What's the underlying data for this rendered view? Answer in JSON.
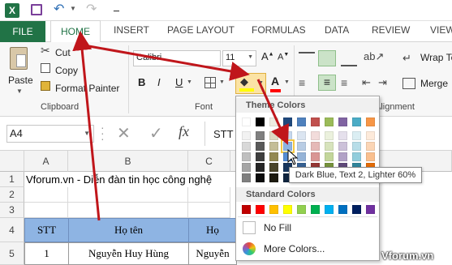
{
  "ribbon_tabs": [
    "FILE",
    "HOME",
    "INSERT",
    "PAGE LAYOUT",
    "FORMULAS",
    "DATA",
    "REVIEW",
    "VIEW"
  ],
  "clipboard": {
    "paste": "Paste",
    "cut": "Cut",
    "copy": "Copy",
    "format_painter": "Format Painter",
    "group": "Clipboard"
  },
  "font": {
    "name": "Calibri",
    "size": "11",
    "bold": "B",
    "italic": "I",
    "underline": "U",
    "group": "Font",
    "font_color_letter": "A"
  },
  "alignment": {
    "wrap": "Wrap Text",
    "merge": "Merge",
    "group": "Alignment"
  },
  "formula_bar": {
    "name_box": "A4",
    "fx": "fx",
    "content": "STT"
  },
  "columns": [
    "A",
    "B",
    "C"
  ],
  "rows": [
    "1",
    "2",
    "3",
    "4",
    "5"
  ],
  "sheet": {
    "title": "Vforum.vn - Diễn đàn tin học công nghệ",
    "headers": [
      "STT",
      "Họ tên",
      "Họ"
    ],
    "row5": [
      "1",
      "Nguyễn Huy Hùng",
      "Nguyễn"
    ]
  },
  "popup": {
    "theme_title": "Theme Colors",
    "standard_title": "Standard Colors",
    "no_fill": "No Fill",
    "more": "More Colors...",
    "tooltip": "Dark Blue, Text 2, Lighter 60%"
  },
  "theme_colors": [
    [
      "#ffffff",
      "#000000",
      "#eeece1",
      "#1f497d",
      "#4f81bd",
      "#c0504d",
      "#9bbb59",
      "#8064a2",
      "#4bacc6",
      "#f79646"
    ],
    [
      "#f2f2f2",
      "#7f7f7f",
      "#ddd9c3",
      "#c6d9f0",
      "#dbe5f1",
      "#f2dcdb",
      "#ebf1dd",
      "#e5e0ec",
      "#dbeef3",
      "#fdeada"
    ],
    [
      "#d8d8d8",
      "#595959",
      "#c4bd97",
      "#8db3e2",
      "#b8cce4",
      "#e5b9b7",
      "#d7e3bc",
      "#ccc1d9",
      "#b7dde8",
      "#fbd5b5"
    ],
    [
      "#bfbfbf",
      "#3f3f3f",
      "#938953",
      "#548dd4",
      "#95b3d7",
      "#d99694",
      "#c3d69b",
      "#b2a2c7",
      "#92cddc",
      "#fac08f"
    ],
    [
      "#a5a5a5",
      "#262626",
      "#494429",
      "#17365d",
      "#366092",
      "#953734",
      "#76923c",
      "#5f497a",
      "#31859b",
      "#e36c09"
    ],
    [
      "#7f7f7f",
      "#0c0c0c",
      "#1d1b10",
      "#0f243e",
      "#244061",
      "#632423",
      "#4f6128",
      "#3f3151",
      "#205867",
      "#974806"
    ]
  ],
  "standard_colors": [
    "#c00000",
    "#ff0000",
    "#ffc000",
    "#ffff00",
    "#92d050",
    "#00b050",
    "#00b0f0",
    "#0070c0",
    "#002060",
    "#7030a0"
  ],
  "colors": {
    "excel_green": "#217346",
    "header_fill": "#8eb4e3",
    "arrow": "#c0161b",
    "highlight": "#f4c842"
  },
  "watermark": "Vforum.vn"
}
